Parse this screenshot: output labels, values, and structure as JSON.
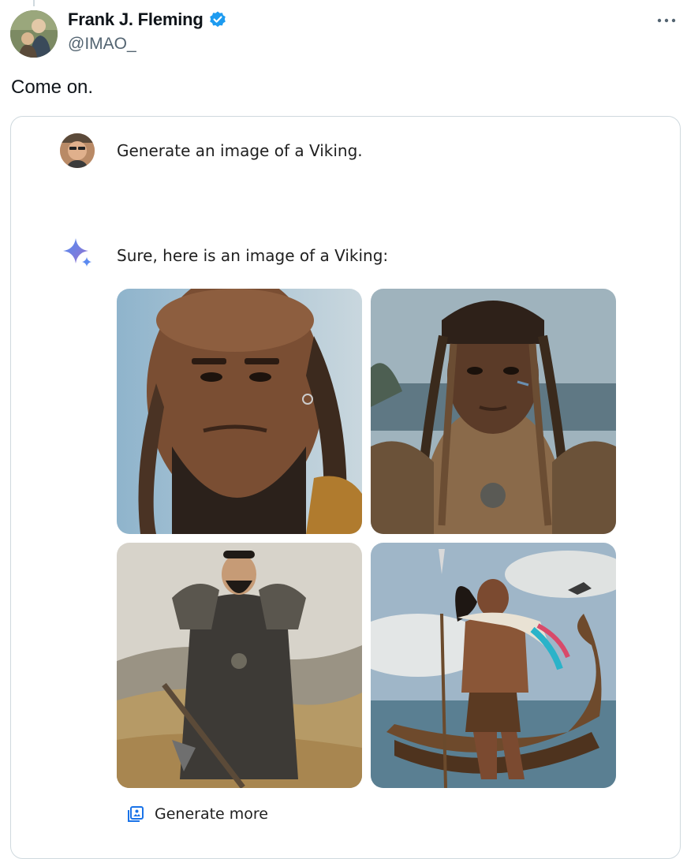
{
  "tweet": {
    "author_name": "Frank J. Fleming",
    "handle": "@IMAO_",
    "text": "Come on.",
    "more_icon": "more-horizontal-icon",
    "verified_color": "#1d9bf0"
  },
  "embed": {
    "prompt": "Generate an image of a Viking.",
    "response": "Sure, here is an image of a Viking:",
    "sparkle_icon": "gemini-sparkle-icon",
    "images_count_label": "",
    "generate_more_label": "Generate more",
    "generate_more_icon": "generate-more-icon"
  }
}
